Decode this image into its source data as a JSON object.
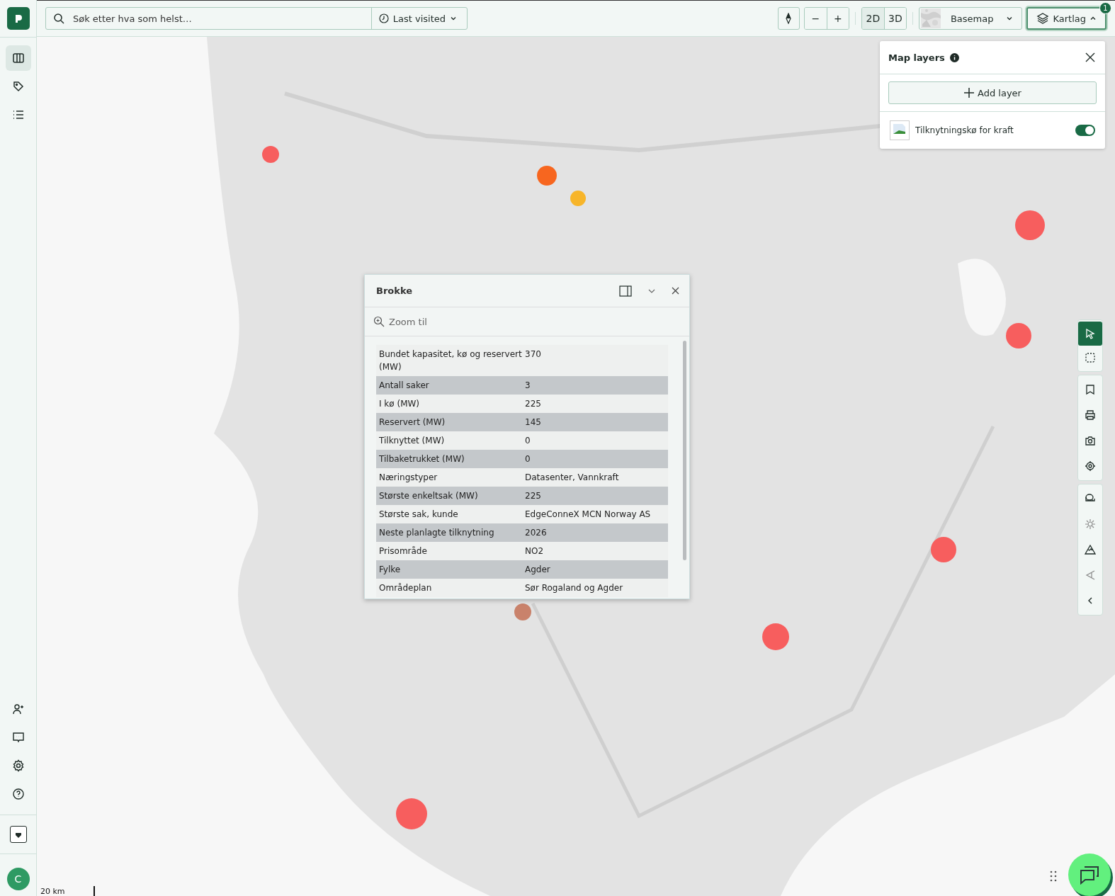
{
  "search": {
    "placeholder": "Søk etter hva som helst…",
    "recent_button": "Last visited"
  },
  "sidebar": {
    "items": [
      {
        "selected": true
      },
      {
        "selected": false
      },
      {
        "selected": false
      }
    ],
    "avatar": "C"
  },
  "map_controls": {
    "zoom_out": "−",
    "zoom_in": "+",
    "view_modes": [
      {
        "label": "2D",
        "selected": true
      },
      {
        "label": "3D",
        "selected": false
      }
    ],
    "basemap": "Basemap",
    "layers_button": {
      "label": "Kartlag",
      "badge": "1",
      "expanded": true
    }
  },
  "layers_panel": {
    "title": "Map layers",
    "add_button": "Add layer",
    "layers": [
      {
        "name": "Tilknytningskø for kraft",
        "on": true
      }
    ]
  },
  "popup": {
    "title": "Brokke",
    "zoom_link": "Zoom til",
    "rows": [
      {
        "label": "Bundet kapasitet, kø og reservert (MW)",
        "value": "370"
      },
      {
        "label": "Antall saker",
        "value": "3"
      },
      {
        "label": "I kø (MW)",
        "value": "225"
      },
      {
        "label": "Reservert (MW)",
        "value": "145"
      },
      {
        "label": "Tilknyttet (MW)",
        "value": "0"
      },
      {
        "label": "Tilbaketrukket (MW)",
        "value": "0"
      },
      {
        "label": "Næringstyper",
        "value": "Datasenter, Vannkraft"
      },
      {
        "label": "Største enkeltsak (MW)",
        "value": "225"
      },
      {
        "label": "Største sak, kunde",
        "value": "EdgeConneX MCN Norway AS"
      },
      {
        "label": "Neste planlagte tilknytning",
        "value": "2026"
      },
      {
        "label": "Prisområde",
        "value": "NO2"
      },
      {
        "label": "Fylke",
        "value": "Agder"
      },
      {
        "label": "Områdeplan",
        "value": "Sør Rogaland og Agder"
      }
    ]
  },
  "tools": [
    {
      "selected": true
    },
    {
      "selected": false
    }
  ],
  "scale": "20 km"
}
